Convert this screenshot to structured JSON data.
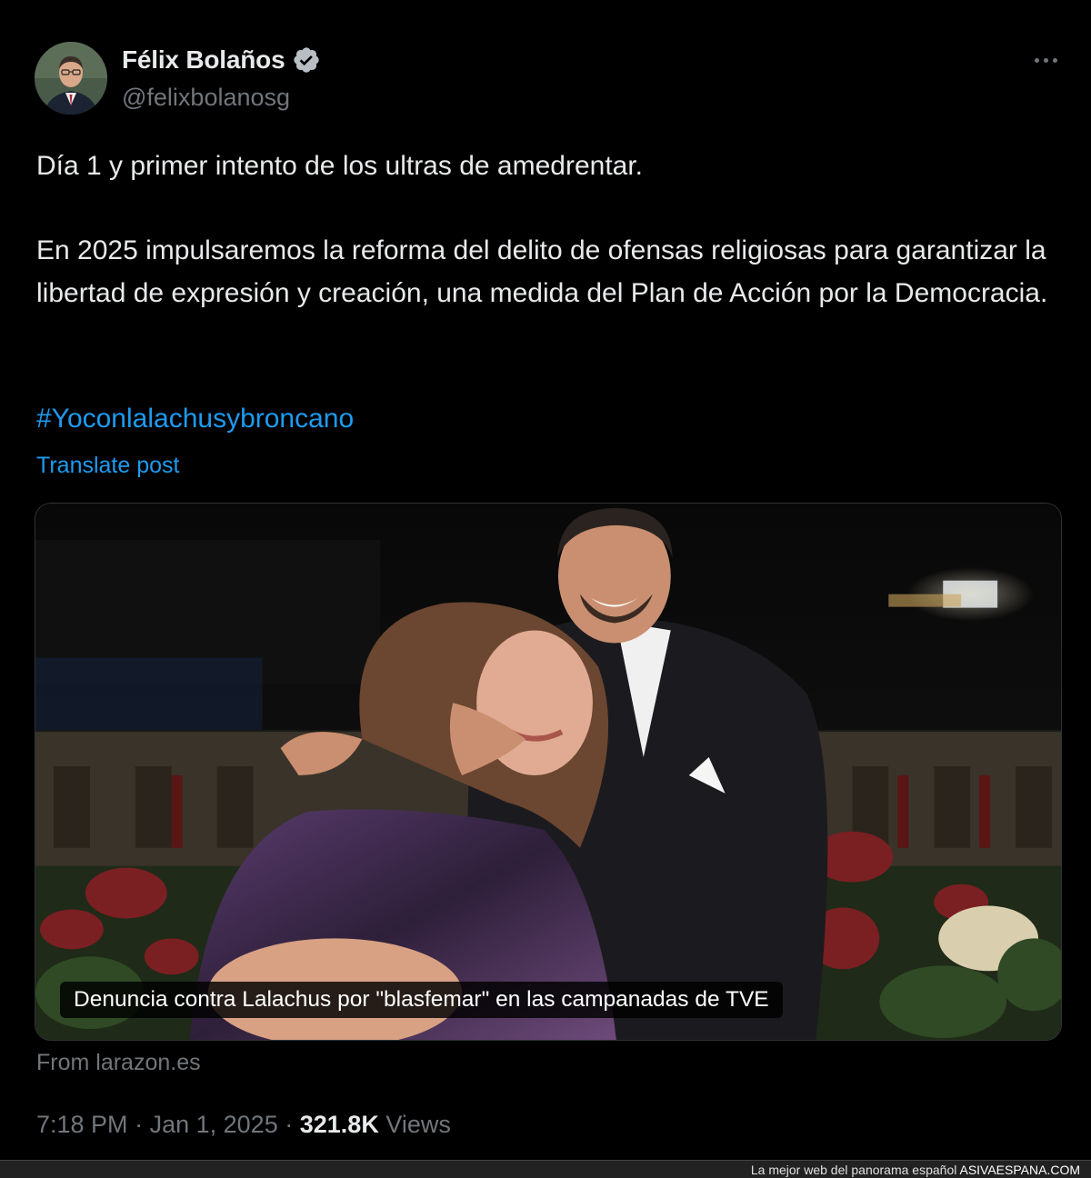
{
  "author": {
    "display_name": "Félix Bolaños",
    "handle": "@felixbolanosg",
    "verified": true
  },
  "post": {
    "paragraphs": [
      "Día 1 y primer intento de los ultras de amedrentar.",
      "En 2025 impulsaremos la reforma del delito de ofensas religiosas para garantizar la libertad de expresión y creación, una medida del Plan de Acción por la Democracia."
    ],
    "hashtag": "#Yoconlalachusybroncano",
    "translate_label": "Translate post"
  },
  "media_card": {
    "caption": "Denuncia contra Lalachus por \"blasfemar\" en las campanadas de TVE",
    "source": "From larazon.es"
  },
  "meta": {
    "time": "7:18 PM",
    "separator": "·",
    "date": "Jan 1, 2025",
    "views_count": "321.8K",
    "views_label": "Views"
  },
  "footer": {
    "tagline": "La mejor web del panorama español",
    "brand": "ASIVAESPANA.COM"
  },
  "icons": {
    "verified": "verified-badge-icon",
    "more": "more-options-icon"
  },
  "colors": {
    "accent": "#1d9bf0",
    "text": "#e7e9ea",
    "muted": "#71767b",
    "background": "#000000"
  }
}
